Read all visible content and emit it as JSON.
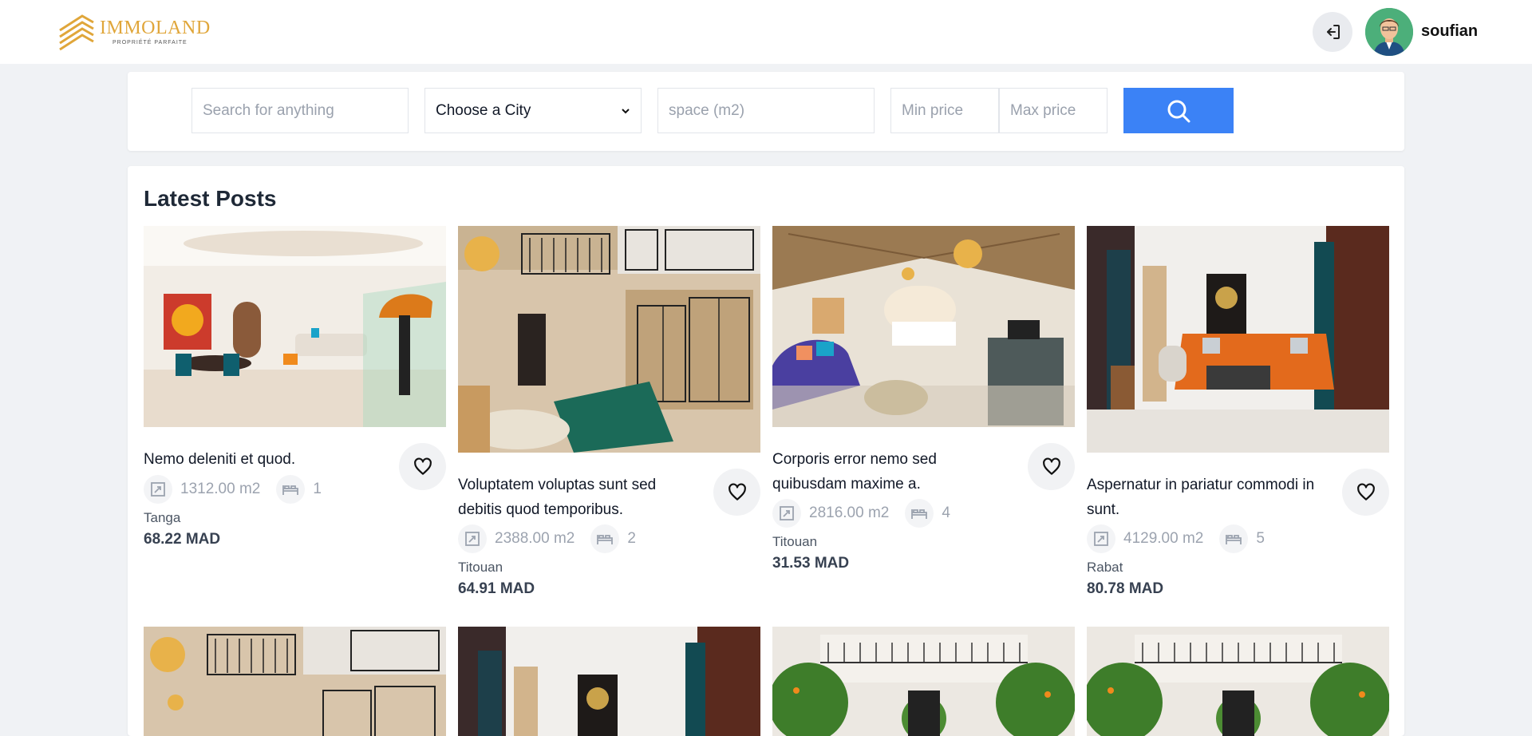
{
  "brand": {
    "name": "IMMOLAND",
    "tagline": "PROPRIÉTÉ PARFAITE",
    "color": "#e0a63a"
  },
  "user": {
    "name": "soufian"
  },
  "search": {
    "query_placeholder": "Search for anything",
    "city_selected": "Choose a City",
    "space_placeholder": "space (m2)",
    "min_price_placeholder": "Min price",
    "max_price_placeholder": "Max price",
    "button_color": "#3b82f6"
  },
  "section_title": "Latest Posts",
  "posts": [
    {
      "title_lines": [
        "Nemo deleniti et quod.",
        ""
      ],
      "space": "1312.00 m2",
      "rooms": "1",
      "city": "Tanga",
      "price": "68.22 MAD",
      "image": "dining-room"
    },
    {
      "title_lines": [
        "Voluptatem voluptas sunt sed",
        "debitis quod temporibus."
      ],
      "space": "2388.00 m2",
      "rooms": "2",
      "city": "Titouan",
      "price": "64.91 MAD",
      "image": "courtyard-pool"
    },
    {
      "title_lines": [
        "Corporis error nemo sed",
        "quibusdam maxime a."
      ],
      "space": "2816.00 m2",
      "rooms": "4",
      "city": "Titouan",
      "price": "31.53 MAD",
      "image": "bedroom-lounge"
    },
    {
      "title_lines": [
        "Aspernatur in pariatur commodi in",
        "sunt."
      ],
      "space": "4129.00 m2",
      "rooms": "5",
      "city": "Rabat",
      "price": "80.78 MAD",
      "image": "living-room"
    }
  ],
  "second_row_images": [
    "courtyard-pool",
    "living-room",
    "garden-courtyard",
    "garden-courtyard"
  ]
}
